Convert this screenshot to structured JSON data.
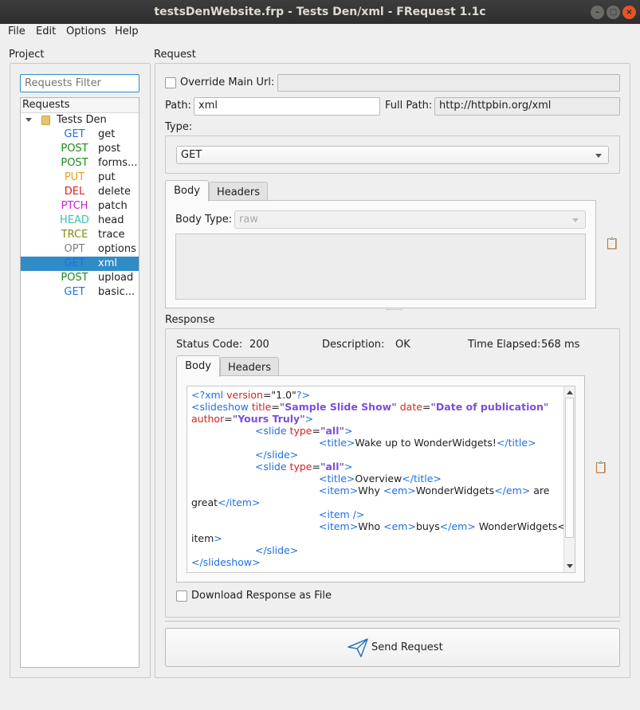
{
  "window": {
    "title": "testsDenWebsite.frp - Tests Den/xml - FRequest 1.1c"
  },
  "menu": [
    "File",
    "Edit",
    "Options",
    "Help"
  ],
  "project": {
    "label": "Project",
    "filter_placeholder": "Requests Filter",
    "tree_header": "Requests",
    "root": "Tests Den",
    "items": [
      {
        "method": "GET",
        "color": "#1f6fe5",
        "name": "get"
      },
      {
        "method": "POST",
        "color": "#1a8a1a",
        "name": "post"
      },
      {
        "method": "POST",
        "color": "#1a8a1a",
        "name": "forms..."
      },
      {
        "method": "PUT",
        "color": "#e0a020",
        "name": "put"
      },
      {
        "method": "DEL",
        "color": "#e0201e",
        "name": "delete"
      },
      {
        "method": "PTCH",
        "color": "#d020d0",
        "name": "patch"
      },
      {
        "method": "HEAD",
        "color": "#40c0b0",
        "name": "head"
      },
      {
        "method": "TRCE",
        "color": "#8a8a10",
        "name": "trace"
      },
      {
        "method": "OPT",
        "color": "#808080",
        "name": "options"
      },
      {
        "method": "GET",
        "color": "#1f6fe5",
        "name": "xml",
        "selected": true
      },
      {
        "method": "POST",
        "color": "#1a8a1a",
        "name": "upload"
      },
      {
        "method": "GET",
        "color": "#1f6fe5",
        "name": "basic..."
      }
    ]
  },
  "request": {
    "label": "Request",
    "override_label": "Override Main Url:",
    "override_value": "",
    "path_label": "Path:",
    "path_value": "xml",
    "full_path_label": "Full Path:",
    "full_path_value": "http://httpbin.org/xml",
    "type_label": "Type:",
    "type_value": "GET",
    "tabs": [
      "Body",
      "Headers"
    ],
    "body_type_label": "Body Type:",
    "body_type_value": "raw"
  },
  "response": {
    "label": "Response",
    "status_label": "Status Code:",
    "status_value": "200",
    "desc_label": "Description:",
    "desc_value": "OK",
    "time_label": "Time Elapsed:",
    "time_value": "568 ms",
    "tabs": [
      "Body",
      "Headers"
    ],
    "download_label": "Download Response as File",
    "body_lines": [
      "<?xml version=\"1.0\"?>",
      "<slideshow title=\"Sample Slide Show\" date=\"Date of publication\"",
      "author=\"Yours Truly\">",
      "<slide type=\"all\">",
      "<title>Wake up to WonderWidgets!</title>",
      "</slide>",
      "<slide type=\"all\">",
      "<title>Overview</title>",
      "<item>Why <em>WonderWidgets</em> are",
      "great</item>",
      "<item />",
      "<item>Who <em>buys</em> WonderWidgets</",
      "item>",
      "</slide>",
      "</slideshow>"
    ]
  },
  "send_label": "Send Request",
  "colors": {
    "accent": "#308cc6",
    "tag": "#1f6fe5",
    "attr": "#d0241e",
    "value": "#7c4fd8"
  }
}
